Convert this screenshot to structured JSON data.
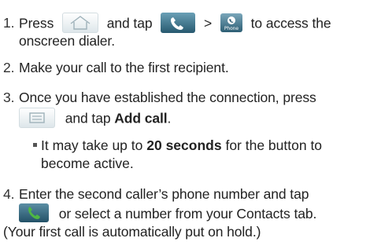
{
  "steps": [
    {
      "number": "1.",
      "before_home": "Press",
      "between_home_call": "and tap",
      "gt": ">",
      "after_phone": "to access the",
      "continuation": "onscreen dialer."
    },
    {
      "number": "2.",
      "text": "Make your call to the first recipient."
    },
    {
      "number": "3.",
      "text": "Once you have established the connection, press",
      "after_menu_pre": "and tap",
      "after_menu_bold": "Add call",
      "after_menu_post": "."
    },
    {
      "number": "4.",
      "text": "Enter the second caller’s phone number and tap",
      "after_call": "or select a number from your Contacts tab.",
      "continuation": "(Your first call is automatically put on hold.)"
    }
  ],
  "note": {
    "pre": "It may take up to",
    "bold": "20 seconds",
    "post": "for the button to",
    "continuation": "become active."
  },
  "icons": {
    "phone_label": "Phone",
    "home": "home-key-icon",
    "call": "call-handset-icon",
    "phone_app": "phone-app-icon",
    "menu": "menu-key-icon",
    "call_button": "call-button-icon"
  },
  "colors": {
    "text": "#222222",
    "icon_blue": "#2d5e74",
    "handset_green": "#4fb843",
    "key_light": "#dde6ea"
  }
}
